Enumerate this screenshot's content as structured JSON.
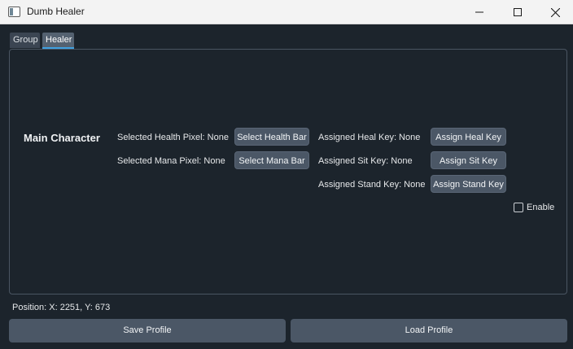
{
  "window": {
    "title": "Dumb Healer",
    "controls": [
      "minimize-icon",
      "maximize-icon",
      "close-icon"
    ]
  },
  "tabs": [
    {
      "label": "Group",
      "active": false
    },
    {
      "label": "Healer",
      "active": true
    }
  ],
  "healer": {
    "section_title": "Main Character",
    "health_pixel_label": "Selected Health Pixel: None",
    "mana_pixel_label": "Selected Mana Pixel: None",
    "select_health_button": "Select Health Bar",
    "select_mana_button": "Select Mana Bar",
    "heal_key_label": "Assigned Heal Key: None",
    "sit_key_label": "Assigned Sit Key: None",
    "stand_key_label": "Assigned Stand Key: None",
    "assign_heal_button": "Assign Heal Key",
    "assign_sit_button": "Assign Sit Key",
    "assign_stand_button": "Assign Stand Key",
    "enable_label": "Enable",
    "enable_checked": false
  },
  "footer": {
    "position_text": "Position: X: 2251, Y: 673",
    "save_button": "Save Profile",
    "load_button": "Load Profile"
  },
  "colors": {
    "background": "#1c242c",
    "button": "#4b5766",
    "active_tab_underline": "#3fa0e0"
  }
}
